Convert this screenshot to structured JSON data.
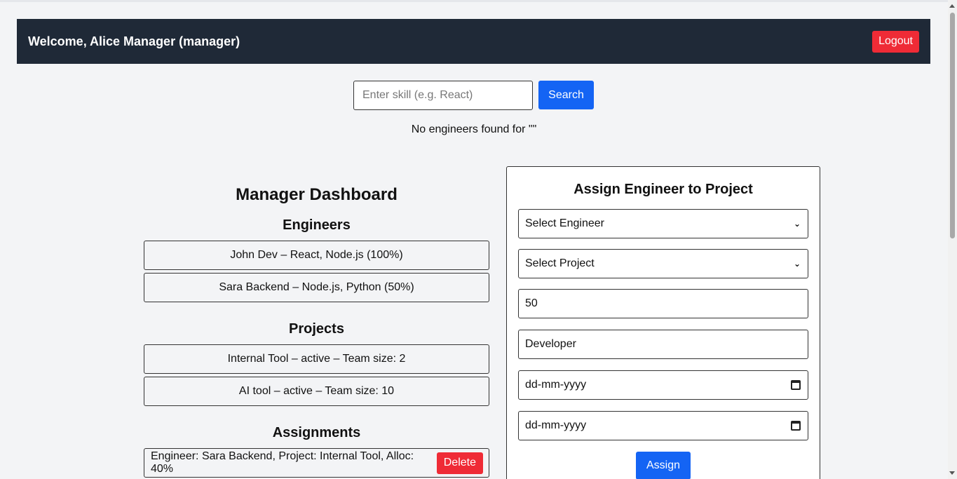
{
  "header": {
    "welcome": "Welcome, Alice Manager (manager)",
    "logout_label": "Logout"
  },
  "search": {
    "placeholder": "Enter skill (e.g. React)",
    "value": "",
    "button_label": "Search",
    "result_text": "No engineers found for \"\""
  },
  "dashboard": {
    "title": "Manager Dashboard",
    "engineers_heading": "Engineers",
    "engineers": [
      "John Dev – React, Node.js (100%)",
      "Sara Backend – Node.js, Python (50%)"
    ],
    "projects_heading": "Projects",
    "projects": [
      "Internal Tool – active – Team size: 2",
      "AI tool – active – Team size: 10"
    ],
    "assignments_heading": "Assignments",
    "assignments": [
      {
        "text": "Engineer: Sara Backend, Project: Internal Tool, Alloc: 40%",
        "delete_label": "Delete"
      }
    ]
  },
  "assign_form": {
    "title": "Assign Engineer to Project",
    "engineer_select": "Select Engineer",
    "project_select": "Select Project",
    "allocation_value": "50",
    "role_value": "Developer",
    "start_date_placeholder": "dd-mm-yyyy",
    "end_date_placeholder": "dd-mm-yyyy",
    "submit_label": "Assign"
  },
  "colors": {
    "header_bg": "#1f2937",
    "danger": "#ef2b36",
    "primary": "#1464f4",
    "page_bg": "#f3f4f6"
  }
}
